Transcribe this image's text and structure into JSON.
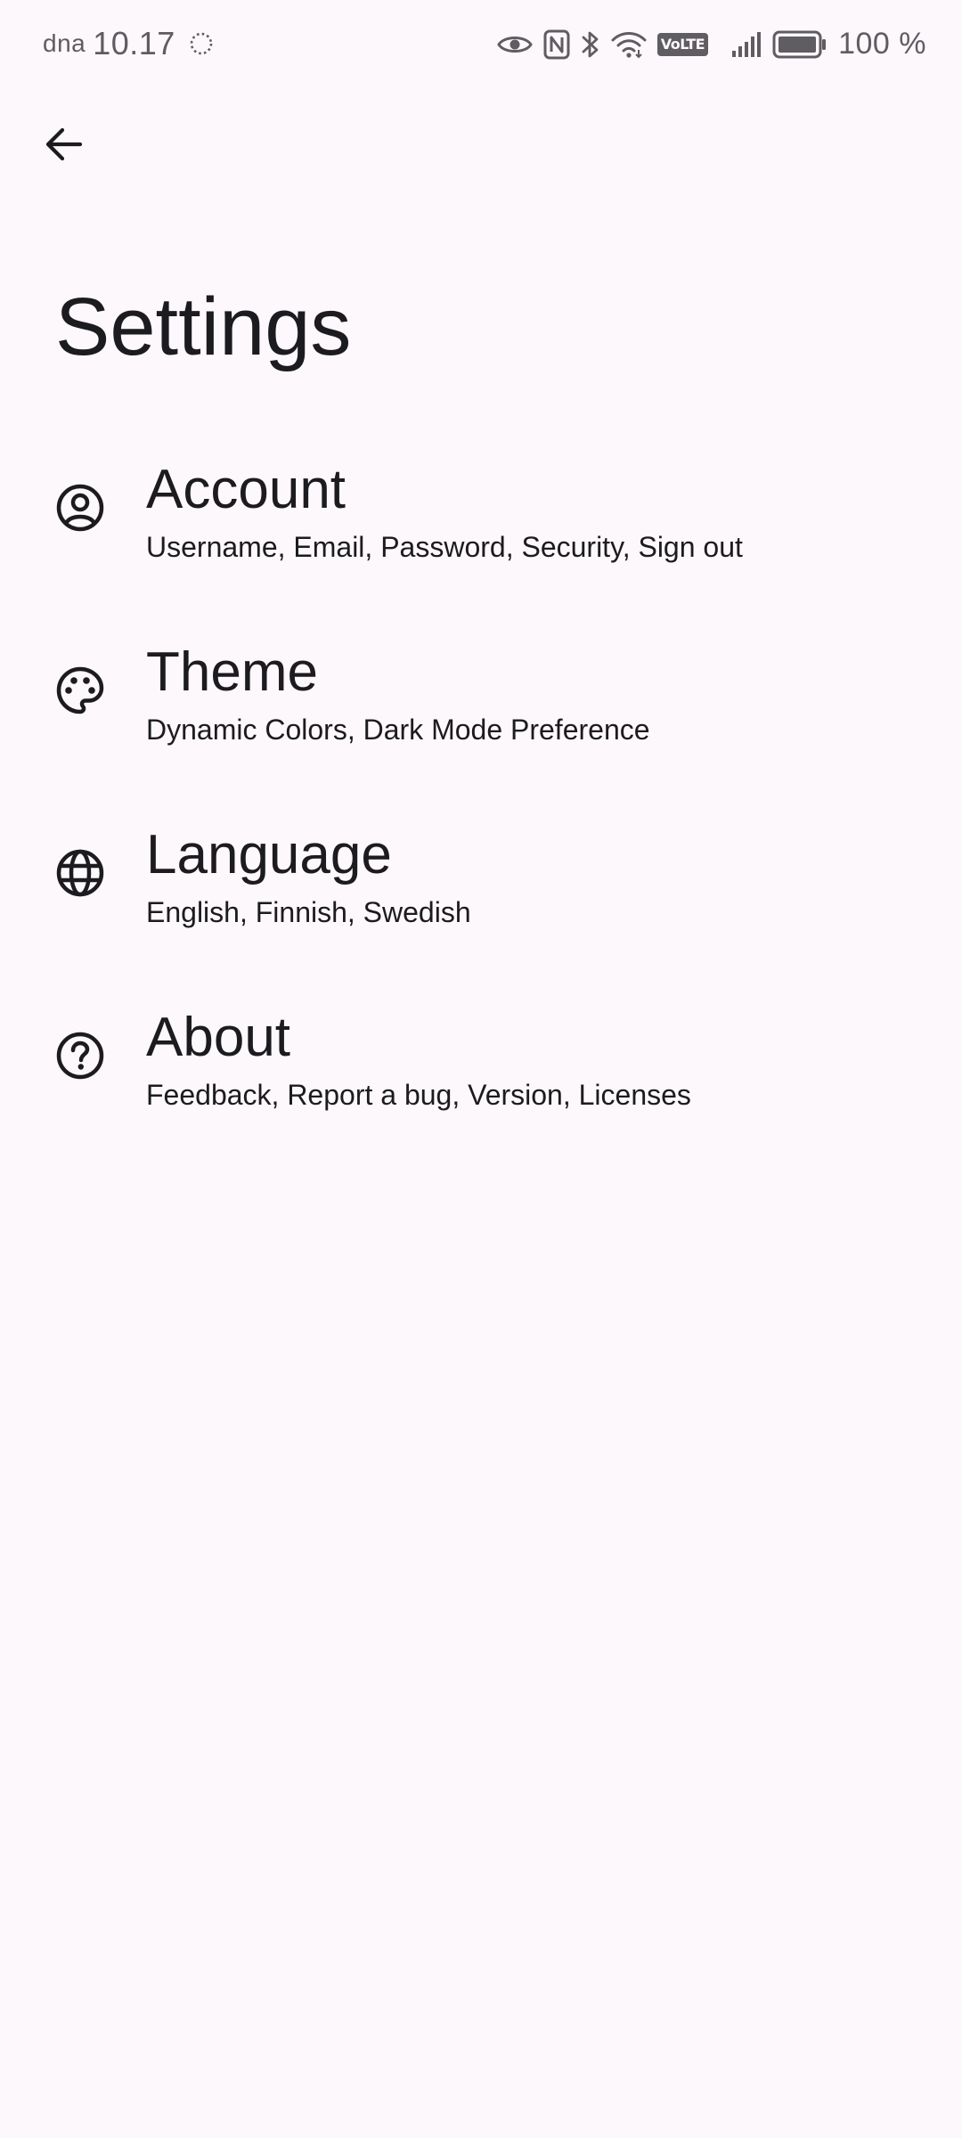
{
  "status_bar": {
    "carrier": "dna",
    "time": "10.17",
    "battery_percent": "100 %",
    "volte_label": "VoLTE",
    "icons": [
      "sync-icon",
      "eye-icon",
      "nfc-icon",
      "bluetooth-icon",
      "wifi-icon",
      "volte-icon",
      "signal-icon",
      "battery-icon"
    ]
  },
  "header": {
    "back_icon": "arrow-back-icon",
    "title": "Settings"
  },
  "settings": {
    "items": [
      {
        "icon": "account-circle-icon",
        "title": "Account",
        "subtitle": "Username, Email, Password, Security, Sign out"
      },
      {
        "icon": "palette-icon",
        "title": "Theme",
        "subtitle": "Dynamic Colors, Dark Mode Preference"
      },
      {
        "icon": "globe-icon",
        "title": "Language",
        "subtitle": "English, Finnish, Swedish"
      },
      {
        "icon": "help-circle-icon",
        "title": "About",
        "subtitle": "Feedback, Report a bug, Version, Licenses"
      }
    ]
  },
  "colors": {
    "background": "#fdf8fb",
    "text": "#1c1b1f",
    "status_text": "#5f5c62"
  }
}
